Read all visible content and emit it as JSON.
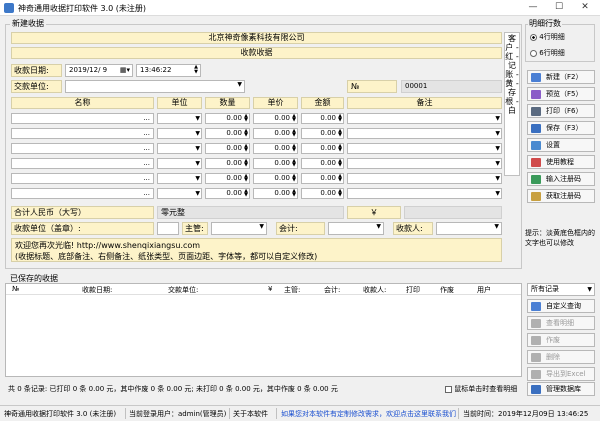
{
  "window": {
    "title": "神奇通用收据打印软件 3.0 (未注册)",
    "min": "—",
    "max": "☐",
    "close": "✕"
  },
  "form": {
    "group_label": "新建收据",
    "company": "北京神奇像素科技有限公司",
    "doc_title": "收款收据",
    "date_label": "收款日期:",
    "date_value": "2019/12/ 9",
    "time_value": "13:46:22",
    "payer_label": "交款单位:",
    "no_label": "№",
    "no_value": "00001",
    "columns": [
      "名称",
      "单位",
      "数量",
      "单价",
      "金额",
      "备注"
    ],
    "dots": "...",
    "zero": "0.00",
    "side_text": "客户 - 红 - 记账 - 黄 - 存根 - 白",
    "total_label": "合计人民币（大写）",
    "total_value": "零元整",
    "yen": "￥",
    "payee_label": "收款单位（盖章）:",
    "supervisor_label": "主管:",
    "accountant_label": "会计:",
    "receiver_label": "收款人:",
    "note_line1": "欢迎您再次光临! http://www.shenqixiangsu.com",
    "note_line2": "(收据标题、底部备注、右侧备注、纸张类型、页面边距、字体等，都可以自定义修改)"
  },
  "right": {
    "rows_label": "明细行数",
    "opt4": "4行明细",
    "opt6": "6行明细",
    "buttons": [
      {
        "label": "新建（F2）",
        "color": "#4a7fd4"
      },
      {
        "label": "预览（F5）",
        "color": "#8a5cc8"
      },
      {
        "label": "打印（F6）",
        "color": "#5a6a80"
      },
      {
        "label": "保存（F3）",
        "color": "#3a6fc0"
      },
      {
        "label": "设置",
        "color": "#4a8ad0"
      },
      {
        "label": "使用教程",
        "color": "#d04a4a"
      },
      {
        "label": "输入注册码",
        "color": "#3a9a5a"
      },
      {
        "label": "获取注册码",
        "color": "#c8a040"
      }
    ],
    "hint": "提示：淡黄底色框内的文字也可以修改"
  },
  "saved": {
    "label": "已保存的收据",
    "headers": [
      "№",
      "收款日期:",
      "交款单位:",
      "¥",
      "主管:",
      "会计:",
      "收款人:",
      "打印",
      "作废",
      "用户"
    ],
    "filter": "所有记录",
    "buttons": [
      {
        "label": "自定义查询",
        "disabled": false,
        "color": "#4a7fd4"
      },
      {
        "label": "查看明细",
        "disabled": true,
        "color": "#b0b0b0"
      },
      {
        "label": "作废",
        "disabled": true,
        "color": "#b0b0b0"
      },
      {
        "label": "删除",
        "disabled": true,
        "color": "#b0b0b0"
      },
      {
        "label": "导出到Excel",
        "disabled": true,
        "color": "#b0b0b0"
      },
      {
        "label": "管理数据库",
        "disabled": false,
        "color": "#3a6fc0"
      }
    ],
    "summary": "共 0 条记录:  已打印 0 条 0.00 元，其中作废 0 条 0.00 元;  未打印 0 条 0.00 元，其中作废 0 条 0.00 元",
    "dblclick": "鼠标单击时查看明细"
  },
  "status": {
    "app": "神奇通用收据打印软件 3.0 (未注册)",
    "user": "当前登录用户：admin(管理员)",
    "about": "关于本软件",
    "custom": "如果您对本软件有定制修改需求，欢迎点击这里联系我们",
    "time": "当前时间：2019年12月09日 13:46:25"
  },
  "colors": {
    "yellow": "#fdf3c9",
    "accent": "#3d78c8"
  }
}
